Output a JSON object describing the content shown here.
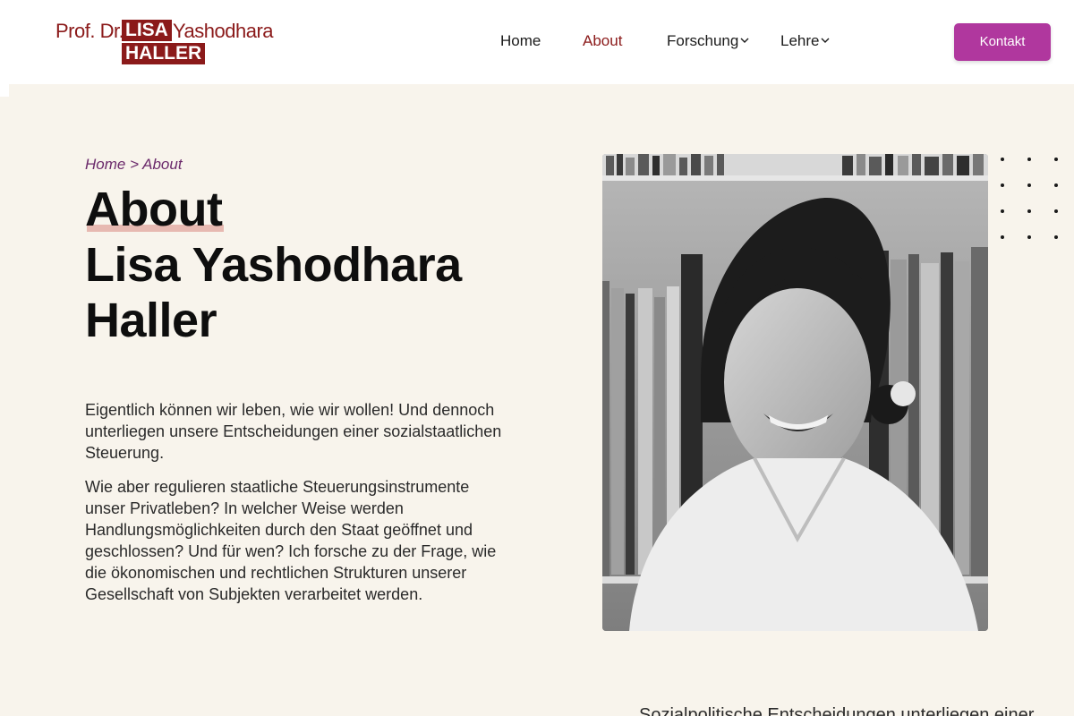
{
  "logo": {
    "prof": "Prof. Dr.",
    "first": "LISA",
    "middle": "Yashodhara",
    "last": "HALLER"
  },
  "nav": {
    "items": [
      {
        "label": "Home",
        "active": false
      },
      {
        "label": "About",
        "active": true
      },
      {
        "label": "Forschung",
        "active": false,
        "dropdown": true
      },
      {
        "label": "Lehre",
        "active": false,
        "dropdown": true
      }
    ],
    "contact_label": "Kontakt"
  },
  "breadcrumb": {
    "home": "Home",
    "separator": ">",
    "current": "About"
  },
  "hero": {
    "title_line1": "About",
    "title_line2": "Lisa Yashodhara",
    "title_line3": "Haller",
    "para1": "Eigentlich können wir leben, wie wir wollen! Und dennoch unterliegen unsere Entscheidungen einer sozialstaatlichen Steuerung.",
    "para2": "Wie aber regulieren staatliche Steuerungsinstrumente unser Privatleben? In welcher Weise werden Handlungsmöglichkeiten durch den Staat geöffnet und geschlossen? Und für wen? Ich forsche zu der Frage, wie die ökonomischen und rechtlichen Strukturen unserer Gesellschaft von Subjekten verarbeitet werden."
  },
  "bottom_partial_text": "Sozialpolitische Entscheidungen unterliegen einer",
  "colors": {
    "brand": "#8b1a1a",
    "accent": "#b0379e",
    "breadcrumb": "#6b2a6b",
    "background": "#f8f4ec",
    "highlight": "#e7b9b1"
  }
}
